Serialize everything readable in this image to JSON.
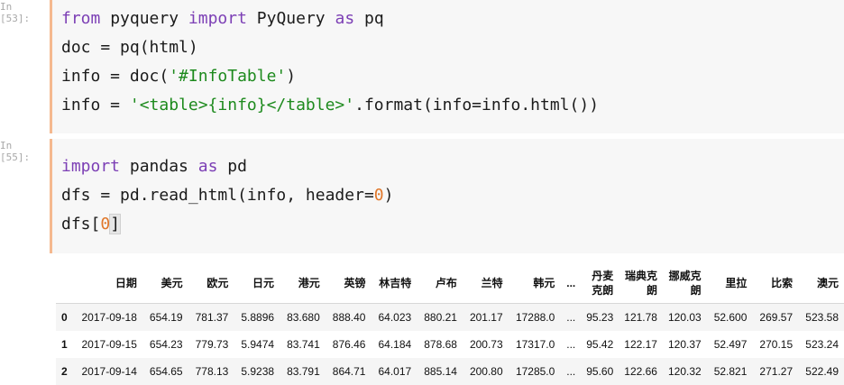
{
  "cells": [
    {
      "prompt": "In [53]:",
      "lines": [
        [
          {
            "t": "from",
            "c": "kw"
          },
          {
            "t": " pyquery "
          },
          {
            "t": "import",
            "c": "kw"
          },
          {
            "t": " PyQuery "
          },
          {
            "t": "as",
            "c": "kw"
          },
          {
            "t": " pq"
          }
        ],
        [
          {
            "t": "doc = pq(html)"
          }
        ],
        [
          {
            "t": "info = doc("
          },
          {
            "t": "'#InfoTable'",
            "c": "str"
          },
          {
            "t": ")"
          }
        ],
        [
          {
            "t": "info = "
          },
          {
            "t": "'<table>{info}</table>'",
            "c": "str"
          },
          {
            "t": ".format(info=info.html())"
          }
        ]
      ]
    },
    {
      "prompt": "In [55]:",
      "lines": [
        [
          {
            "t": "import",
            "c": "kw"
          },
          {
            "t": " pandas "
          },
          {
            "t": "as",
            "c": "kw"
          },
          {
            "t": " pd"
          }
        ],
        [
          {
            "t": "dfs = pd.read_html(info, header="
          },
          {
            "t": "0",
            "c": "num"
          },
          {
            "t": ")"
          }
        ],
        [
          {
            "t": "dfs["
          },
          {
            "t": "0",
            "c": "num"
          },
          {
            "t": "]",
            "c": "bracket-hl"
          }
        ]
      ]
    }
  ],
  "table": {
    "columns": [
      "",
      "日期",
      "美元",
      "欧元",
      "日元",
      "港元",
      "英镑",
      "林吉特",
      "卢布",
      "兰特",
      "韩元",
      "...",
      "丹麦克朗",
      "瑞典克朗",
      "挪威克朗",
      "里拉",
      "比索",
      "澳元"
    ],
    "rows": [
      [
        "0",
        "2017-09-18",
        "654.19",
        "781.37",
        "5.8896",
        "83.680",
        "888.40",
        "64.023",
        "880.21",
        "201.17",
        "17288.0",
        "...",
        "95.23",
        "121.78",
        "120.03",
        "52.600",
        "269.57",
        "523.58"
      ],
      [
        "1",
        "2017-09-15",
        "654.23",
        "779.73",
        "5.9474",
        "83.741",
        "876.46",
        "64.184",
        "878.68",
        "200.73",
        "17317.0",
        "...",
        "95.42",
        "122.17",
        "120.37",
        "52.497",
        "270.15",
        "523.24"
      ],
      [
        "2",
        "2017-09-14",
        "654.65",
        "778.13",
        "5.9238",
        "83.791",
        "864.71",
        "64.017",
        "885.14",
        "200.80",
        "17285.0",
        "...",
        "95.60",
        "122.66",
        "120.32",
        "52.821",
        "271.27",
        "522.49"
      ]
    ]
  }
}
